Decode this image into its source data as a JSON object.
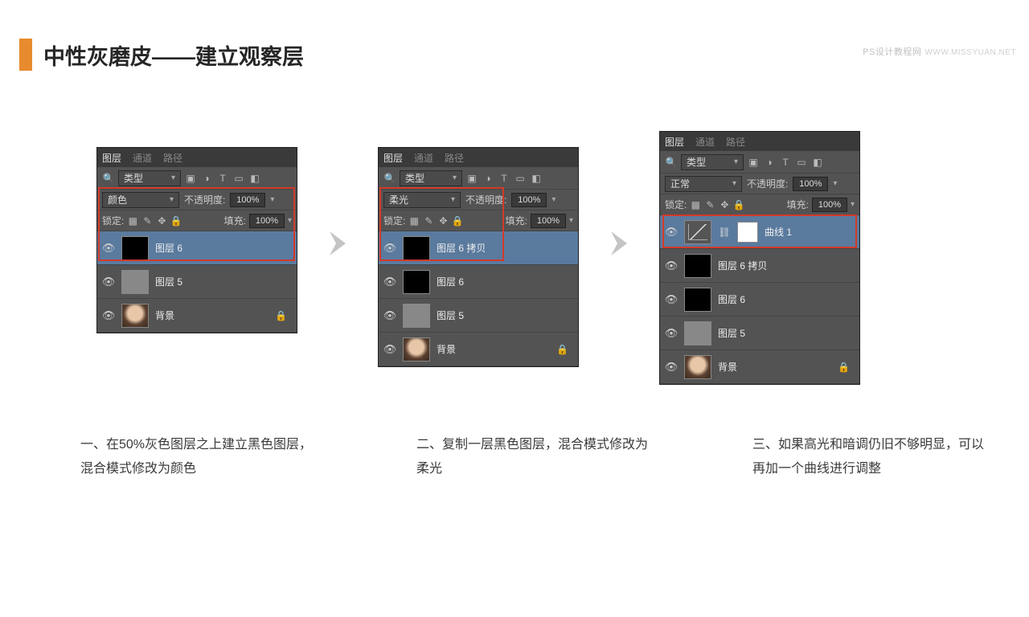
{
  "watermark": {
    "site": "PS设计教程网",
    "url": "WWW.MISSYUAN.NET"
  },
  "title": "中性灰磨皮——建立观察层",
  "tabs": {
    "layers": "图层",
    "channels": "通道",
    "paths": "路径"
  },
  "kind_label": "类型",
  "modes": {
    "color": "颜色",
    "softlight": "柔光",
    "normal": "正常"
  },
  "labels": {
    "opacity": "不透明度:",
    "opacity_short": "不透明度:",
    "fill": "填充:",
    "lock": "锁定:",
    "pct": "100%"
  },
  "layers": {
    "layer6": "图层 6",
    "layer5": "图层 5",
    "bg": "背景",
    "layer6copy": "图层 6 拷贝",
    "curves1": "曲线 1"
  },
  "captions": {
    "c1": "一、在50%灰色图层之上建立黑色图层，混合模式修改为颜色",
    "c2": "二、复制一层黑色图层，混合模式修改为柔光",
    "c3": "三、如果高光和暗调仍旧不够明显，可以再加一个曲线进行调整"
  }
}
